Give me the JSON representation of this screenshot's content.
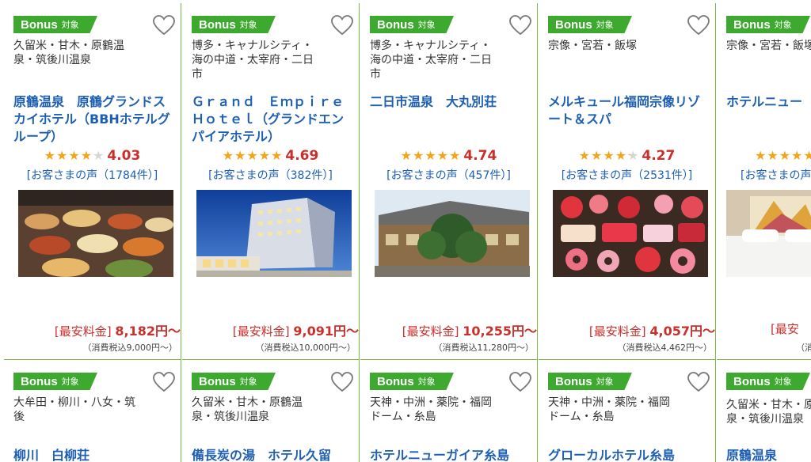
{
  "badge": {
    "bonus": "Bonus",
    "target": "対象"
  },
  "colors": {
    "accent_green": "#3daa2f",
    "border_green": "#7ab648",
    "link_blue": "#1d5fb3",
    "price_red": "#c9302c",
    "star": "#f2a51a"
  },
  "hotels": [
    {
      "area": "久留米・甘木・原鶴温泉・筑後川温泉",
      "name": "原鶴温泉　原鶴グランドスカイホテル（BBHホテルグループ）",
      "stars": "★★★★★",
      "score": "4.03",
      "reviews": "[お客さまの声（1784件）]",
      "price_label": "[最安料金]",
      "price": "8,182円〜",
      "tax": "（消費税込9,000円〜）",
      "photo": "buffet"
    },
    {
      "area": "博多・キャナルシティ・海の中道・太宰府・二日市",
      "name": "Ｇｒａｎｄ　Ｅｍｐｉｒｅ　Ｈｏｔｅｌ（グランドエンパイアホテル）",
      "stars": "★★★★★",
      "score": "4.69",
      "reviews": "[お客さまの声（382件）]",
      "price_label": "[最安料金]",
      "price": "9,091円〜",
      "tax": "（消費税込10,000円〜）",
      "photo": "building"
    },
    {
      "area": "博多・キャナルシティ・海の中道・太宰府・二日市",
      "name": "二日市温泉　大丸別荘",
      "stars": "★★★★★",
      "score": "4.74",
      "reviews": "[お客さまの声（457件）]",
      "price_label": "[最安料金]",
      "price": "10,255円〜",
      "tax": "（消費税込11,280円〜）",
      "photo": "ryokan"
    },
    {
      "area": "宗像・宮若・飯塚",
      "name": "メルキュール福岡宗像リゾート＆スパ",
      "stars": "★★★★★",
      "score": "4.27",
      "reviews": "[お客さまの声（2531件）]",
      "price_label": "[最安料金]",
      "price": "4,057円〜",
      "tax": "（消費税込4,462円〜）",
      "photo": "sweets"
    },
    {
      "area": "宗像・宮若・飯塚",
      "name": "ホテルニュー",
      "stars": "★★★★★",
      "score": "",
      "reviews": "[お客さまの声",
      "price_label": "[最安",
      "price": "",
      "tax": "（消",
      "photo": "room"
    },
    {
      "area": "大牟田・柳川・八女・筑後",
      "name": "柳川　白柳荘"
    },
    {
      "area": "久留米・甘木・原鶴温泉・筑後川温泉",
      "name": "備長炭の湯　ホテル久留"
    },
    {
      "area": "天神・中洲・薬院・福岡ドーム・糸島",
      "name": "ホテルニューガイア糸島"
    },
    {
      "area": "天神・中洲・薬院・福岡ドーム・糸島",
      "name": "グローカルホテル糸島"
    },
    {
      "area": "久留米・甘木・原鶴温泉・筑後川温泉",
      "name": "原鶴温泉"
    }
  ]
}
